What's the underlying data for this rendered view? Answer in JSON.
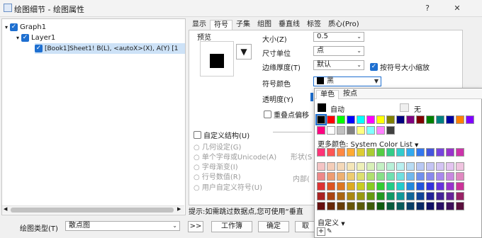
{
  "window": {
    "title": "绘图细节 - 绘图属性",
    "help": "?",
    "close": "✕"
  },
  "tree": {
    "graph": "Graph1",
    "layer": "Layer1",
    "plot": "[Book1]Sheet1! B(L), <autoX>(X), A(Y) [1"
  },
  "tabs": [
    {
      "label": "显示"
    },
    {
      "label": "符号"
    },
    {
      "label": "子集"
    },
    {
      "label": "组图"
    },
    {
      "label": "垂直线"
    },
    {
      "label": "标签"
    },
    {
      "label": "质心(Pro)"
    }
  ],
  "symbol": {
    "preview_label": "预览",
    "size_label": "大小(Z)",
    "size_value": "0.5",
    "unit_label": "尺寸单位",
    "unit_value": "点",
    "edge_label": "边缘厚度(T)",
    "edge_value": "默认",
    "scale_label": "按符号大小缩放",
    "color_label": "符号颜色",
    "color_value": "黑",
    "transparency_label": "透明度(Y)",
    "overlap_label": "重叠点偏移",
    "custom_struct_label": "自定义结构(U)",
    "radio_geometry": "几何设定(G)",
    "radio_char": "单个字母或Unicode(A)",
    "radio_gradient": "字母渐变(I)",
    "radio_row": "行号数值(R)",
    "radio_user": "用户自定义符号(U)",
    "shape_label": "形状(S",
    "inner_label": "内部(",
    "tip": "提示:如需跳过数据点,您可使用“垂直"
  },
  "bottom": {
    "plot_type_label": "绘图类型(T)",
    "plot_type_value": "散点图",
    "more_button": ">>",
    "workbook_button": "工作簿",
    "ok_button": "确定",
    "cancel_button": "取"
  },
  "color_popup": {
    "tab_single": "单色",
    "tab_gradient": "按点",
    "auto_label": "自动",
    "none_label": "无",
    "more_colors_label": "更多颜色: System Color List",
    "custom_label": "自定义",
    "add_label": "+",
    "selected_color": "#000000",
    "row1": [
      "#000000",
      "#ff0000",
      "#00ff00",
      "#0000ff",
      "#00ffff",
      "#ff00ff",
      "#ffff00",
      "#808000",
      "#000080",
      "#800080",
      "#800000",
      "#008000",
      "#008080",
      "#0000a0",
      "#ff8000",
      "#8000ff"
    ],
    "row2": [
      "#ff0080",
      "#ffffff",
      "#c0c0c0",
      "#808080",
      "#ffff80",
      "#80ffff",
      "#ff80ff",
      "#404040"
    ],
    "system": [
      "#ff3377",
      "#ff5555",
      "#ff8844",
      "#ffaa33",
      "#ddcc33",
      "#aacc33",
      "#55cc44",
      "#33cc88",
      "#33cccc",
      "#33aaee",
      "#3377ee",
      "#4455dd",
      "#7744dd",
      "#9933cc",
      "#cc33aa"
    ],
    "tints": [
      [
        "#f4c4c4",
        "#f4cdb8",
        "#f4d8b8",
        "#f4e6b8",
        "#eef0b8",
        "#d8f0b8",
        "#c4f0c4",
        "#b8f0d8",
        "#b8f0f0",
        "#b8dcf4",
        "#b8c8f4",
        "#c4c4f4",
        "#d4c4f4",
        "#e4c4f0",
        "#f0c4e0"
      ],
      [
        "#ee8888",
        "#ee9c70",
        "#eeb070",
        "#eecc70",
        "#dde070",
        "#b0e070",
        "#88e088",
        "#70e0b0",
        "#70e0e0",
        "#70b8ee",
        "#7090ee",
        "#8888ee",
        "#a888ee",
        "#c888e0",
        "#e088c0"
      ],
      [
        "#dd3333",
        "#dd5522",
        "#dd7722",
        "#ddaa22",
        "#c8cc22",
        "#88cc22",
        "#33cc33",
        "#22cc88",
        "#22cccc",
        "#2288dd",
        "#2255dd",
        "#3333dd",
        "#6633dd",
        "#9933cc",
        "#cc3399"
      ],
      [
        "#aa2222",
        "#aa4411",
        "#aa6611",
        "#aa8811",
        "#999911",
        "#669911",
        "#229922",
        "#119966",
        "#119999",
        "#116699",
        "#114499",
        "#222299",
        "#442299",
        "#662299",
        "#992266"
      ],
      [
        "#660f0f",
        "#662808",
        "#663d08",
        "#665508",
        "#5a5a08",
        "#3d5a08",
        "#0f5a0f",
        "#085a3d",
        "#085a5a",
        "#083d66",
        "#082866",
        "#0f0f66",
        "#280f66",
        "#3d0f5a",
        "#5a0f3d"
      ]
    ]
  }
}
